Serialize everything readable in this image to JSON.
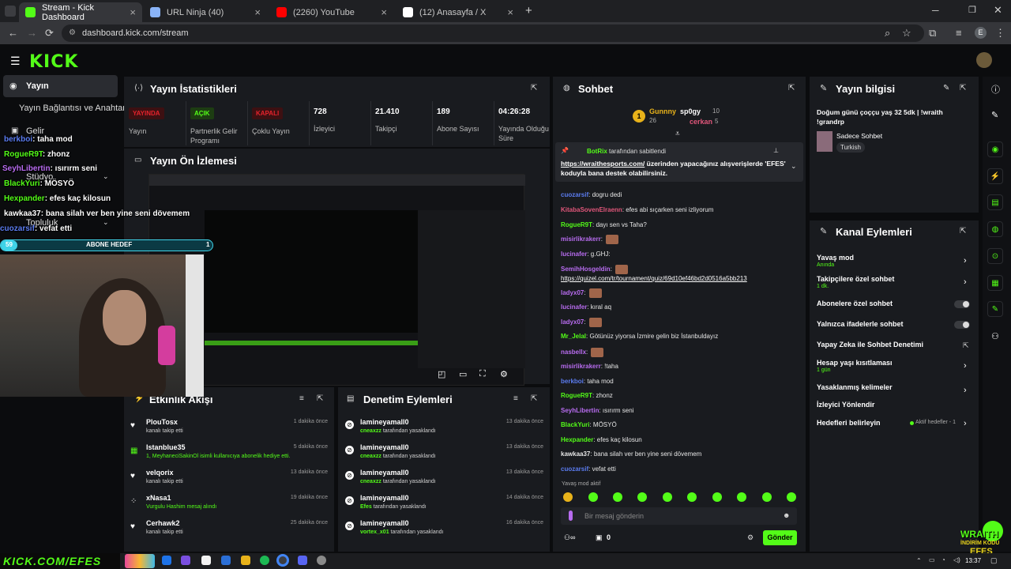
{
  "browser": {
    "tabs": [
      {
        "title": "Stream - Kick Dashboard",
        "active": true,
        "icon": "kick-icon",
        "color": "#53fc18"
      },
      {
        "title": "URL Ninja (40)",
        "active": false,
        "icon": "doc-icon",
        "color": "#8ab4f8"
      },
      {
        "title": "(2260) YouTube",
        "active": false,
        "icon": "youtube-icon",
        "color": "#ff0000"
      },
      {
        "title": "(12) Anasayfa / X",
        "active": false,
        "icon": "x-icon",
        "color": "#ffffff"
      }
    ],
    "url": "dashboard.kick.com/stream",
    "profile_initial": "E"
  },
  "kick": {
    "logo": "KICK",
    "sidebar": {
      "items": [
        "Yayın",
        "Yayın Bağlantısı ve Anahtarı",
        "Gelir",
        "Stüdyo",
        "Topluluk"
      ]
    },
    "overlay": {
      "chat": [
        {
          "user": "berkboi",
          "msg": ": taha mod",
          "color": "#5b7cf0"
        },
        {
          "user": "RogueR9T",
          "msg": ": zhonz",
          "color": "#53fc18"
        },
        {
          "user": "SeyhLibertin",
          "msg": ": ısırırm seni",
          "color": "#b86cf0"
        },
        {
          "user": "BlackYuri",
          "msg": ": MÖSYÖ",
          "color": "#53fc18"
        },
        {
          "user": "Hexpander",
          "msg": ": efes kaç kilosun",
          "color": "#53fc18"
        },
        {
          "user": "kawkaa37",
          "msg": ": bana silah ver ben yine seni dövemem",
          "color": "#ffffff"
        },
        {
          "user": "cuozarsif",
          "msg": ": vefat etti",
          "color": "#5b7cf0"
        }
      ],
      "sub_goal_left": "59",
      "sub_goal_label": "ABONE HEDEF",
      "sub_goal_right": "1",
      "sub_goal_progress": 0.08,
      "bottom_banner": "KICK.COM/EFES",
      "wraith_line1": "WRAITH",
      "wraith_line2": "İNDİRİM KODU",
      "wraith_line3": "EFES"
    },
    "stats": {
      "title": "Yayın İstatistikleri",
      "items": [
        {
          "badge": "YAYINDA",
          "badge_color": "#e5232c",
          "label": "Yayın"
        },
        {
          "badge": "AÇIK",
          "badge_color": "#53fc18",
          "label": "Partnerlik Gelir Programı"
        },
        {
          "badge": "KAPALI",
          "badge_color": "#e5232c",
          "label": "Çoklu Yayın"
        },
        {
          "value": "728",
          "label": "İzleyici"
        },
        {
          "value": "21.410",
          "label": "Takipçi"
        },
        {
          "value": "189",
          "label": "Abone Sayısı"
        },
        {
          "value": "04:26:28",
          "label": "Yayında Olduğu Süre"
        }
      ]
    },
    "preview": {
      "title": "Yayın Ön İzlemesi"
    },
    "activity": {
      "title": "Etkinlik Akışı",
      "rows": [
        {
          "name": "PlouTosx",
          "desc": "kanalı takip etti",
          "time": "1 dakika önce",
          "icon": "heart-icon"
        },
        {
          "name": "Istanblue35",
          "desc": "1, MeyhaneciSakinOl isimli kullanıcıya abonelik hediye etti.",
          "time": "5 dakika önce",
          "icon": "gift-icon"
        },
        {
          "name": "velqorix",
          "desc": "kanalı takip etti",
          "time": "13 dakika önce",
          "icon": "heart-icon"
        },
        {
          "name": "xNasa1",
          "desc": "Vurgulu Hashim mesaj alındı",
          "time": "19 dakika önce",
          "icon": "highlight-icon"
        },
        {
          "name": "Cerhawk2",
          "desc": "kanalı takip etti",
          "time": "25 dakika önce",
          "icon": "heart-icon"
        }
      ]
    },
    "moderation": {
      "title": "Denetim Eylemleri",
      "rows": [
        {
          "name": "lamineyamall0",
          "by": "cneaxzz",
          "desc": "tarafından yasaklandı",
          "time": "13 dakika önce"
        },
        {
          "name": "lamineyamall0",
          "by": "cneaxzz",
          "desc": "tarafından yasaklandı",
          "time": "13 dakika önce"
        },
        {
          "name": "lamineyamall0",
          "by": "cneaxzz",
          "desc": "tarafından yasaklandı",
          "time": "13 dakika önce"
        },
        {
          "name": "lamineyamall0",
          "by": "Efes",
          "desc": "tarafından yasaklandı",
          "time": "14 dakika önce"
        },
        {
          "name": "lamineyamall0",
          "by": "vortex_x01",
          "desc": "tarafından yasaklandı",
          "time": "16 dakika önce"
        }
      ]
    },
    "chat": {
      "title": "Sohbet",
      "leaders": {
        "first": "Gunnny",
        "first_count": "26",
        "second": "sp0gy",
        "second_count": "10",
        "third": "cerkan",
        "third_count": "5"
      },
      "pinned_by": "BotRix",
      "pinned_suffix": "tarafından sabitlendi",
      "pinned_link": "https://wraithesports.com/",
      "pinned_text": "üzerinden yapacağınız alışverişlerde 'EFES' koduyla bana destek olabilirsiniz.",
      "messages": [
        {
          "user": "cuozarsif",
          "msg": ": dogru dedi",
          "color": "#5b7cf0"
        },
        {
          "user": "KitabaSovenElraenn",
          "msg": ": efes abi sıçarken seni izliyorum",
          "color": "#e0567a"
        },
        {
          "user": "RogueR9T",
          "msg": ": dayı sen vs Taha?",
          "color": "#53fc18"
        },
        {
          "user": "misirlikrakerr",
          "msg": ":",
          "color": "#b86cf0"
        },
        {
          "user": "lucinafer",
          "msg": ": g.GHJ:",
          "color": "#b86cf0"
        },
        {
          "user": "SemihHosgeldin",
          "msg": ":",
          "color": "#b86cf0"
        },
        {
          "user": "",
          "msg": "https://quizel.com/tr/tournament/quiz/69d10ef46bd2d0516a5bb213",
          "color": "#ffffff"
        },
        {
          "user": "ladyx07",
          "msg": ":",
          "color": "#b86cf0"
        },
        {
          "user": "lucinafer",
          "msg": ": kıral aq",
          "color": "#b86cf0"
        },
        {
          "user": "ladyx07",
          "msg": ":",
          "color": "#b86cf0"
        },
        {
          "user": "Mr_Jelal",
          "msg": ": Götünüz yiyorsa İzmire gelin biz İstanbuldayız",
          "color": "#53fc18"
        },
        {
          "user": "nasbellx",
          "msg": ":",
          "color": "#b86cf0"
        },
        {
          "user": "misirlikrakerr",
          "msg": ": !taha",
          "color": "#b86cf0"
        },
        {
          "user": "berkboi",
          "msg": ": taha mod",
          "color": "#5b7cf0"
        },
        {
          "user": "RogueR9T",
          "msg": ": zhonz",
          "color": "#53fc18"
        },
        {
          "user": "SeyhLibertin",
          "msg": ": ısırırm seni",
          "color": "#b86cf0"
        },
        {
          "user": "BlackYuri",
          "msg": ": MÖSYÖ",
          "color": "#53fc18"
        },
        {
          "user": "Hexpander",
          "msg": ": efes kaç kilosun",
          "color": "#53fc18"
        },
        {
          "user": "kawkaa37",
          "msg": ": bana silah ver ben yine seni dövemem",
          "color": "#e6e6e6"
        },
        {
          "user": "cuozarsif",
          "msg": ": vefat etti",
          "color": "#5b7cf0"
        }
      ],
      "slow_mode": "Yavaş mod aktif",
      "placeholder": "Bir mesaj gönderin",
      "points": "0",
      "send_label": "Gönder"
    },
    "info": {
      "title": "Yayın bilgisi",
      "stream_title": "Doğum günü çoççu yaş 32 5dk | !wraith !grandrp",
      "category": "Sadece Sohbet",
      "tag": "Turkish"
    },
    "channel_actions": {
      "title": "Kanal Eylemleri",
      "items": [
        {
          "label": "Yavaş mod",
          "sub": "Anında",
          "type": "chevron"
        },
        {
          "label": "Takipçilere özel sohbet",
          "sub": "1 dk.",
          "type": "chevron"
        },
        {
          "label": "Abonelere özel sohbet",
          "sub": "",
          "type": "toggle"
        },
        {
          "label": "Yalnızca ifadelerle sohbet",
          "sub": "",
          "type": "toggle"
        },
        {
          "label": "Yapay Zeka ile Sohbet Denetimi",
          "sub": "",
          "type": "external"
        },
        {
          "label": "Hesap yaşı kısıtlaması",
          "sub": "1 gün",
          "type": "chevron"
        },
        {
          "label": "Yasaklanmış kelimeler",
          "sub": "",
          "type": "chevron"
        },
        {
          "label": "İzleyici Yönlendir",
          "sub": "",
          "type": "none"
        },
        {
          "label": "Hedefleri belirleyin",
          "sub": "",
          "type": "goals",
          "extra": "Aktif hedefler - 1"
        }
      ]
    }
  },
  "taskbar": {
    "time": "13:37"
  },
  "colors": {
    "accent": "#53fc18",
    "panel": "#191b1f",
    "bg": "#0b0c0e",
    "live": "#e5232c"
  }
}
